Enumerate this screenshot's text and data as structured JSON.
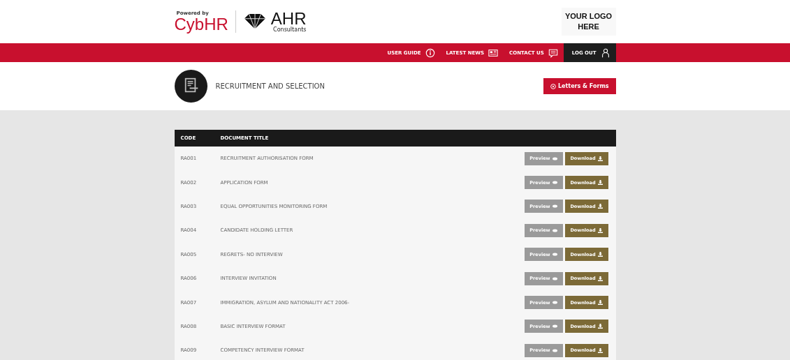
{
  "header": {
    "powered_by": "Powered by",
    "brand": "CybHR",
    "partner": "AHR",
    "partner_sub": "Consultants",
    "client_logo": "YOUR LOGO HERE"
  },
  "nav": [
    {
      "label": "USER GUIDE",
      "kind": "guide"
    },
    {
      "label": "LATEST NEWS",
      "kind": "news"
    },
    {
      "label": "CONTACT US",
      "kind": "contact"
    },
    {
      "label": "LOG OUT",
      "kind": "logout"
    }
  ],
  "section": {
    "title": "RECRUITMENT AND SELECTION",
    "button": "Letters & Forms"
  },
  "table": {
    "columns": [
      "CODE",
      "DOCUMENT TITLE"
    ],
    "rows": [
      {
        "code": "RA001",
        "title": "RECRUITMENT AUTHORISATION FORM",
        "preview": "Preview",
        "preview_disabled": true,
        "download": "Download"
      },
      {
        "code": "RA002",
        "title": "APPLICATION FORM",
        "preview": "Preview",
        "preview_disabled": true,
        "download": "Download"
      },
      {
        "code": "RA003",
        "title": "EQUAL OPPORTUNITIES MONITORING FORM",
        "preview": "Preview",
        "preview_disabled": true,
        "download": "Download"
      },
      {
        "code": "RA004",
        "title": "CANDIDATE HOLDING LETTER",
        "preview": "Preview",
        "preview_disabled": true,
        "download": "Download"
      },
      {
        "code": "RA005",
        "title": "REGRETS- NO INTERVIEW",
        "preview": "Preview",
        "preview_disabled": true,
        "download": "Download"
      },
      {
        "code": "RA006",
        "title": "INTERVIEW INVITATION",
        "preview": "Preview",
        "preview_disabled": true,
        "download": "Download"
      },
      {
        "code": "RA007",
        "title": "IMMIGRATION, ASYLUM AND NATIONALITY ACT 2006-",
        "preview": "Preview",
        "preview_disabled": true,
        "download": "Download"
      },
      {
        "code": "RA008",
        "title": "BASIC INTERVIEW FORMAT",
        "preview": "Preview",
        "preview_disabled": true,
        "download": "Download"
      },
      {
        "code": "RA009",
        "title": "COMPETENCY INTERVIEW FORMAT",
        "preview": "Preview",
        "preview_disabled": true,
        "download": "Download"
      }
    ]
  }
}
